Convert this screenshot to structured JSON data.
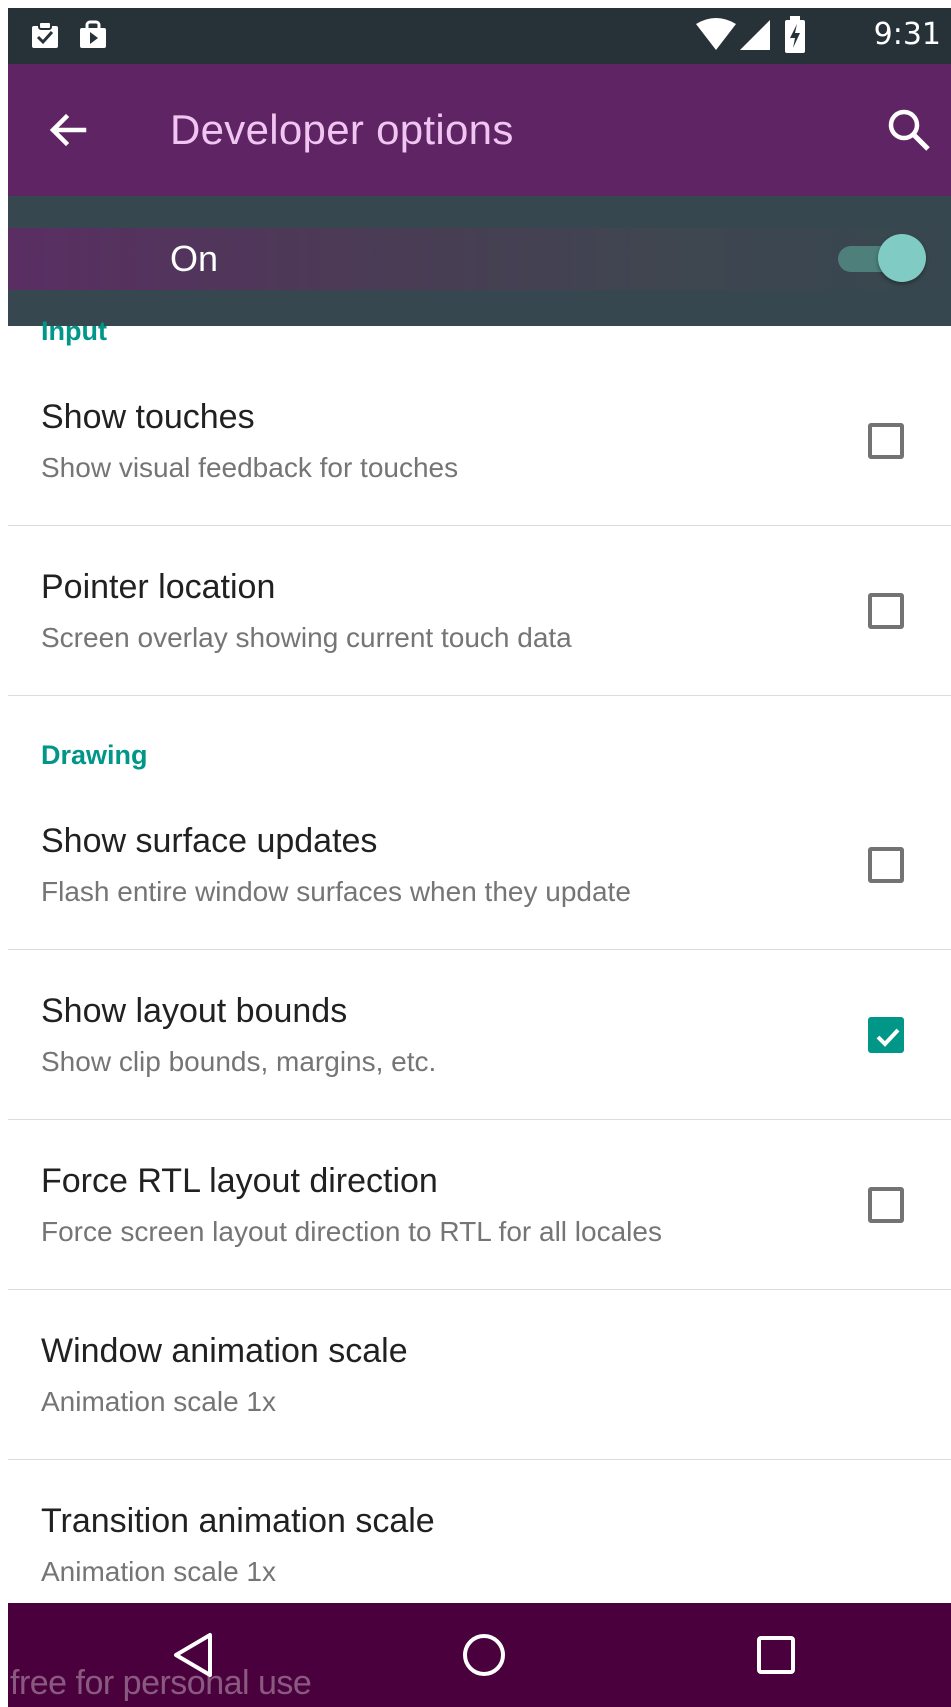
{
  "status_bar": {
    "time": "9:31",
    "icons": [
      "clipboard-check-icon",
      "play-store-bag-icon",
      "wifi-icon",
      "cell-signal-icon",
      "battery-charging-icon"
    ]
  },
  "toolbar": {
    "title": "Developer options",
    "back_icon": "arrow-back-icon",
    "search_icon": "search-icon",
    "color": "#5f2463"
  },
  "master_switch": {
    "label": "On",
    "state": "on",
    "accent": "#80cbc4"
  },
  "sections": {
    "input": "Input",
    "drawing": "Drawing"
  },
  "items": [
    {
      "title": "Show touches",
      "summary": "Show visual feedback for touches",
      "checked": false
    },
    {
      "title": "Pointer location",
      "summary": "Screen overlay showing current touch data",
      "checked": false
    },
    {
      "title": "Show surface updates",
      "summary": "Flash entire window surfaces when they update",
      "checked": false
    },
    {
      "title": "Show layout bounds",
      "summary": "Show clip bounds, margins, etc.",
      "checked": true
    },
    {
      "title": "Force RTL layout direction",
      "summary": "Force screen layout direction to RTL for all locales",
      "checked": false
    },
    {
      "title": "Window animation scale",
      "summary": "Animation scale 1x"
    },
    {
      "title": "Transition animation scale",
      "summary": "Animation scale 1x"
    }
  ],
  "nav_bar": {
    "buttons": [
      "back-triangle-icon",
      "home-circle-icon",
      "recents-square-icon"
    ]
  },
  "watermark": "free for personal use",
  "colors": {
    "section_accent": "#009688",
    "checkbox_checked": "#009688"
  }
}
